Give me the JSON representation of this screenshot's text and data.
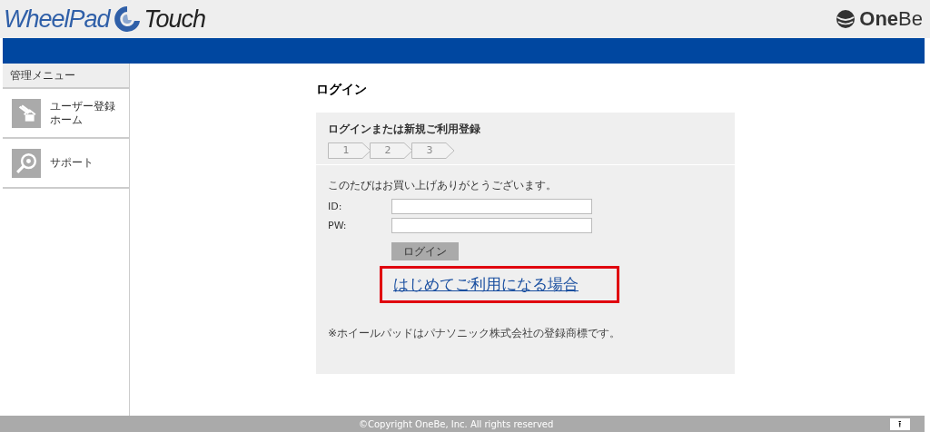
{
  "header": {
    "logo_main": "WheelPad",
    "logo_sub": "Touch",
    "company": "**One**Be"
  },
  "sidebar": {
    "title": "管理メニュー",
    "items": [
      {
        "label": "ユーザー登録ホーム",
        "kind": "home"
      },
      {
        "label": "サポート",
        "kind": "support"
      }
    ]
  },
  "page": {
    "title": "ログイン"
  },
  "login_card": {
    "heading": "ログインまたは新規ご利用登録",
    "steps": [
      "1",
      "2",
      "3"
    ],
    "message": "このたびはお買い上げありがとうございます。",
    "fields": [
      {
        "label": "ID:"
      },
      {
        "label": "PW:"
      }
    ],
    "button": "ログイン",
    "register_link": "はじめてご利用になる場合",
    "note": "※ホイールパッドはパナソニック株式会社の登録商標です。"
  },
  "footer": {
    "copyright": "©Copyright OneBe, Inc. All rights reserved",
    "top_button": "⭱"
  }
}
